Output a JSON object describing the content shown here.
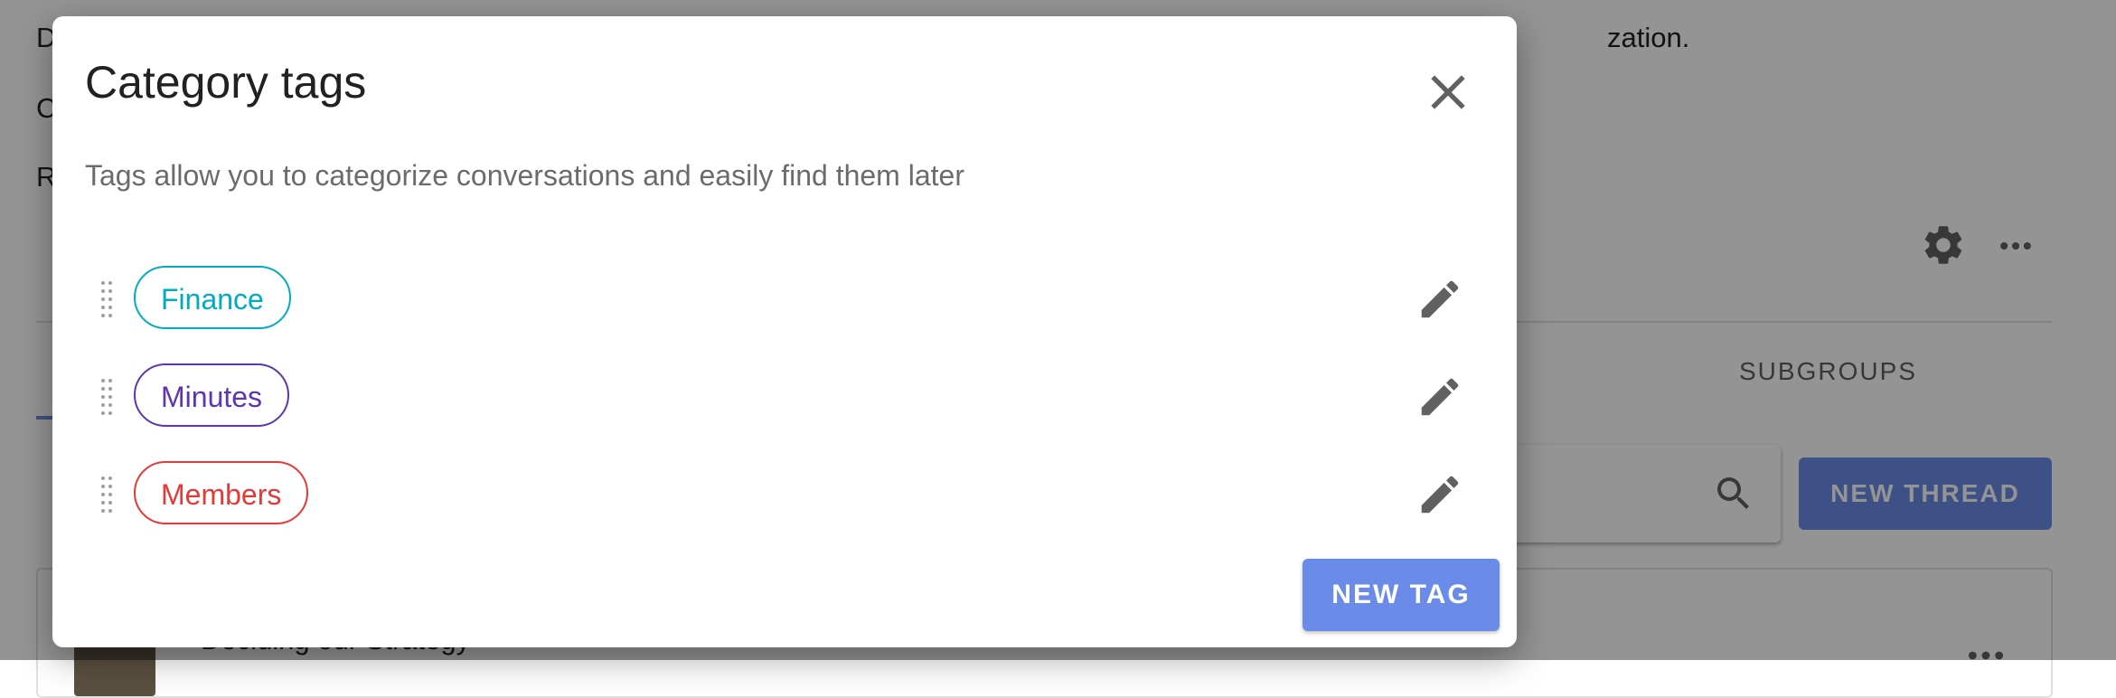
{
  "background": {
    "line_1_start": "D",
    "line_1_tail": "zation.",
    "line_2_start": "C",
    "line_3_start": "R",
    "tab_subgroups": "SUBGROUPS",
    "new_thread_label": "NEW THREAD",
    "card_title": "Deciding our Strategy"
  },
  "dialog": {
    "title": "Category tags",
    "description": "Tags allow you to categorize conversations and easily find them later",
    "tags": [
      {
        "label": "Finance",
        "color": "#00acc1"
      },
      {
        "label": "Minutes",
        "color": "#5e35b1"
      },
      {
        "label": "Members",
        "color": "#e53935"
      }
    ],
    "new_tag_label": "NEW TAG"
  },
  "colors": {
    "primary": "#6a8ce8",
    "icon_gray": "#616161"
  },
  "icons": [
    "close-icon",
    "drag-handle-icon",
    "pencil-icon",
    "gear-icon",
    "more-horizontal-icon",
    "search-icon"
  ]
}
